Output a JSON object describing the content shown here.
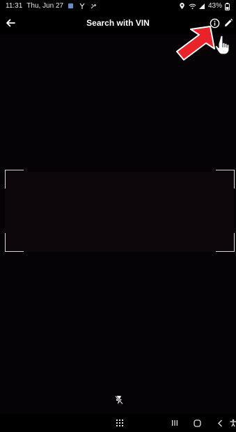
{
  "status_bar": {
    "time": "11:31",
    "date": "Thu, Jun 27",
    "battery": "43%",
    "icons": [
      "gallery-icon",
      "signal-y-icon",
      "key-icon",
      "location-icon",
      "wifi-icon",
      "cell-signal-icon",
      "battery-icon"
    ]
  },
  "top_bar": {
    "title": "Search with VIN",
    "back_icon": "arrow-left-icon",
    "info_icon": "info-circle-icon",
    "edit_icon": "pencil-icon"
  },
  "scanner": {
    "viewfinder": "vin-scan-frame",
    "flash_icon": "flash-off-icon"
  },
  "nav_bar": {
    "icons": [
      "apps-grid-icon",
      "recents-icon",
      "home-icon",
      "back-chevron-icon",
      "accessibility-icon"
    ]
  },
  "annotation": {
    "arrow_color": "#e8232a",
    "pointer": "hand-pointer-icon"
  },
  "colors": {
    "background": "#000000",
    "text": "#ffffff",
    "frame": "#d9d9d9"
  }
}
